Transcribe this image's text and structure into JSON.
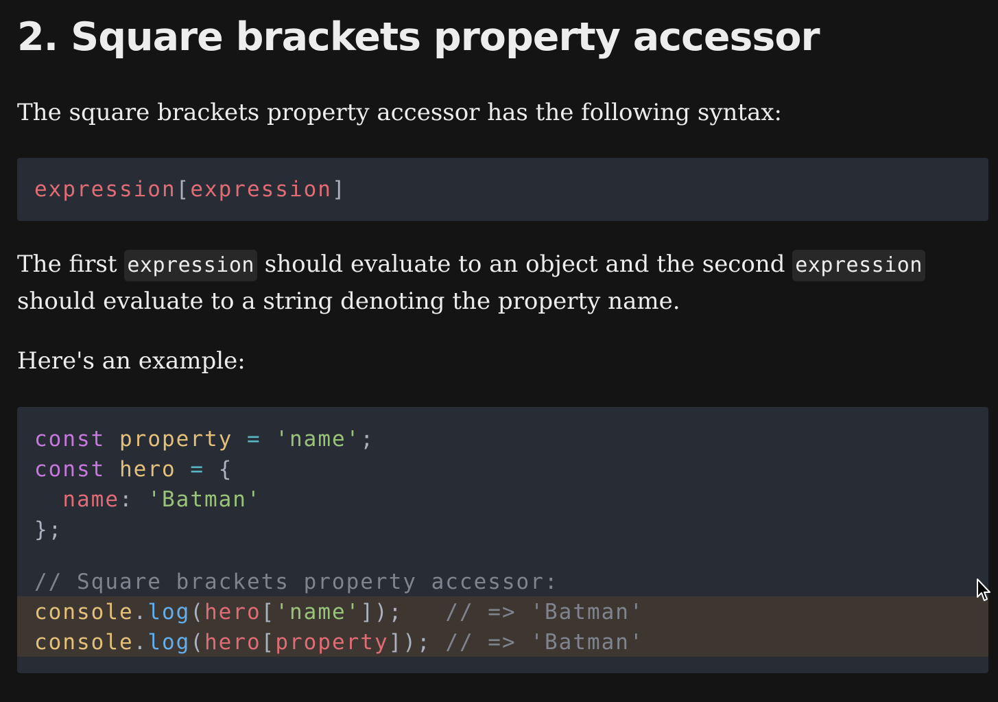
{
  "article": {
    "title": "2. Square brackets property accessor",
    "intro": "The square brackets property accessor has the following syntax:",
    "syntax": {
      "object_expr": "expression",
      "open": "[",
      "key_expr": "expression",
      "close": "]"
    },
    "explain": {
      "part1": "The first ",
      "code1": "expression",
      "part2": " should evaluate to an object and the second ",
      "code2": "expression",
      "part3": "should evaluate to a string denoting the property name."
    },
    "example_intro": "Here's an example:"
  },
  "example_code": {
    "line1": {
      "kw": "const",
      "name": "property",
      "eq": "=",
      "str": "'name'",
      "end": ";"
    },
    "line2": {
      "kw": "const",
      "name": "hero",
      "eq": "=",
      "open": "{"
    },
    "line3": {
      "prop": "name",
      "colon": ":",
      "str": "'Batman'"
    },
    "line4": {
      "close": "};"
    },
    "comment": "// Square brackets property accessor:",
    "line6": {
      "obj": "console",
      "dot": ".",
      "fn": "log",
      "p1": "(",
      "hero": "hero",
      "b1": "[",
      "key": "'name'",
      "b2": "]",
      "p2": ");",
      "comment": "// => 'Batman'"
    },
    "line7": {
      "obj": "console",
      "dot": ".",
      "fn": "log",
      "p1": "(",
      "hero": "hero",
      "b1": "[",
      "key": "property",
      "b2": "]",
      "p2": ");",
      "comment": "// => 'Batman'"
    }
  },
  "icons": {
    "cursor": "mouse-pointer-icon"
  },
  "colors": {
    "background": "#141414",
    "code_background": "#282c35",
    "highlight": "#3e3731",
    "keyword": "#c678dd",
    "variable": "#e5c07b",
    "string": "#98c379",
    "property": "#e06c75",
    "function": "#61afef",
    "comment": "#7f848e"
  }
}
